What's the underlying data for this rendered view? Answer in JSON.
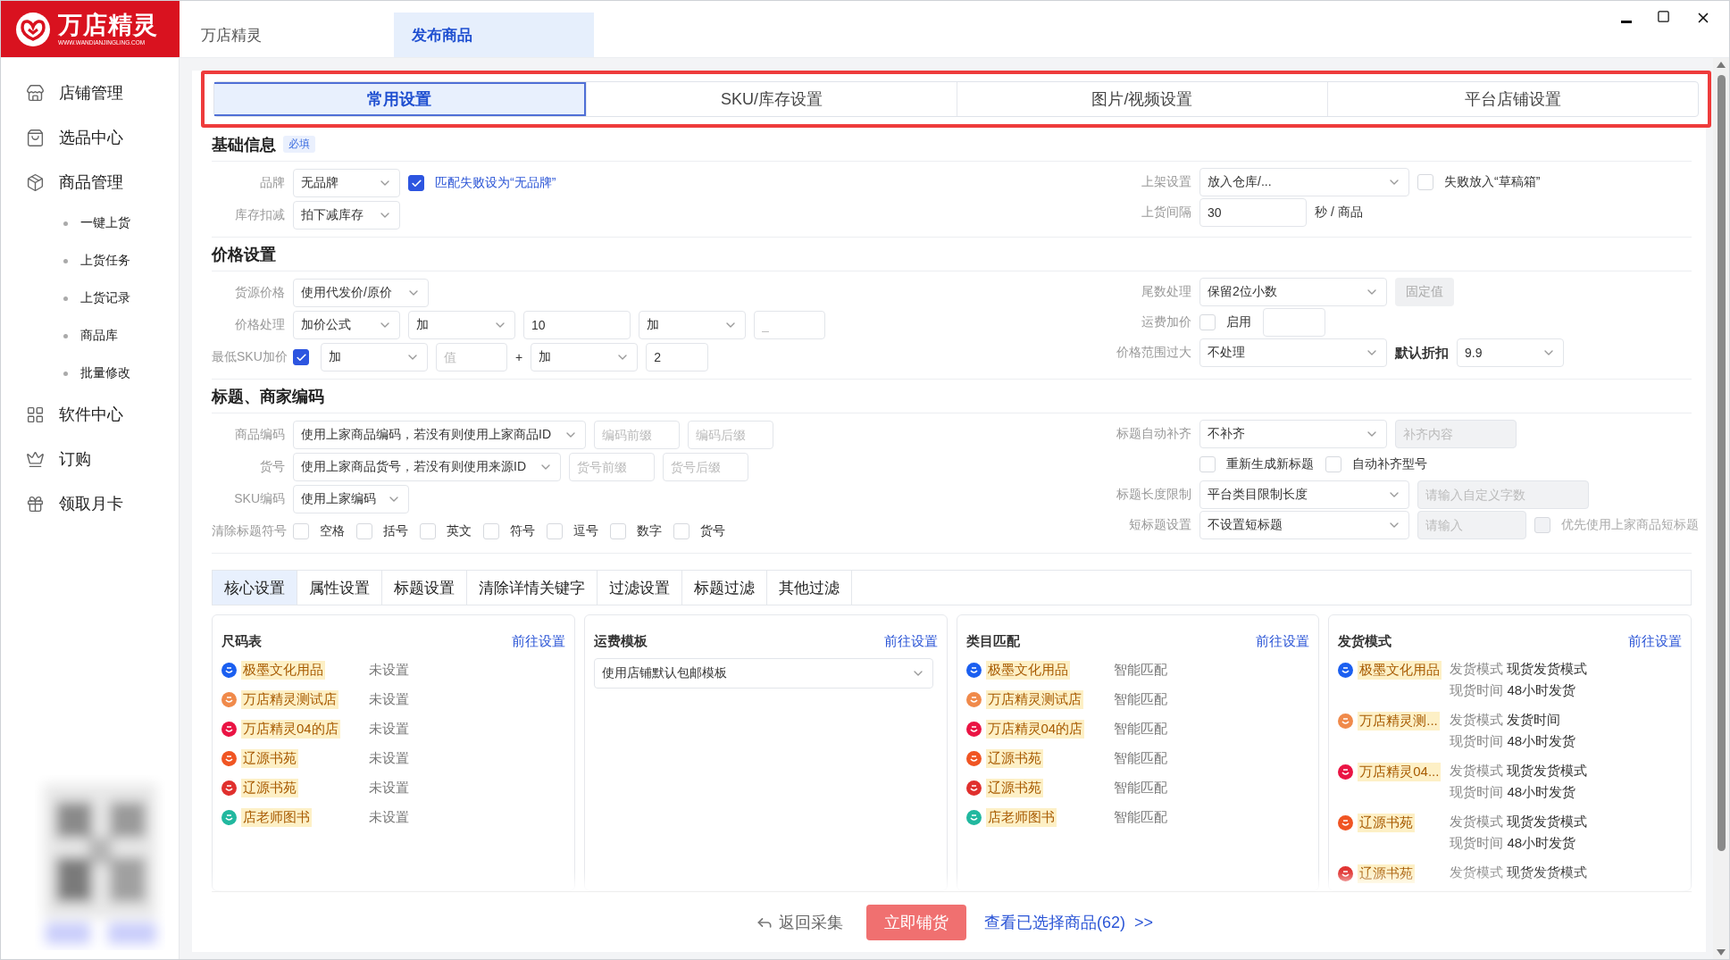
{
  "app": {
    "logo_text": "万店精灵",
    "logo_url": "WWW.WANDIANJINGLING.COM"
  },
  "window_tabs": [
    {
      "label": "万店精灵",
      "selected": false
    },
    {
      "label": "发布商品",
      "selected": true
    }
  ],
  "sidebar": {
    "items": [
      {
        "label": "店铺管理"
      },
      {
        "label": "选品中心"
      },
      {
        "label": "商品管理",
        "children": [
          {
            "label": "一键上货"
          },
          {
            "label": "上货任务"
          },
          {
            "label": "上货记录"
          },
          {
            "label": "商品库"
          },
          {
            "label": "批量修改"
          }
        ]
      },
      {
        "label": "软件中心"
      },
      {
        "label": "订购"
      },
      {
        "label": "领取月卡"
      }
    ]
  },
  "settings_tabs": [
    {
      "label": "常用设置",
      "selected": true
    },
    {
      "label": "SKU/库存设置",
      "selected": false
    },
    {
      "label": "图片/视频设置",
      "selected": false
    },
    {
      "label": "平台店铺设置",
      "selected": false
    }
  ],
  "sections": [
    {
      "title": "基础信息",
      "badge": "必填",
      "left": [
        {
          "label": "品牌",
          "controls": [
            {
              "kind": "select",
              "value": "无品牌"
            },
            {
              "kind": "checkbox",
              "label": "匹配失败设为“无品牌”",
              "checked": true,
              "accent": true
            }
          ]
        },
        {
          "label": "库存扣减",
          "controls": [
            {
              "kind": "select",
              "value": "拍下减库存"
            }
          ]
        }
      ],
      "right": [
        {
          "label": "上架设置",
          "controls": [
            {
              "kind": "select",
              "value": "放入仓库/..."
            },
            {
              "kind": "checkbox",
              "label": "失败放入“草稿箱”",
              "checked": false
            }
          ]
        },
        {
          "label": "上货间隔",
          "controls": [
            {
              "kind": "input",
              "value": "30"
            },
            {
              "kind": "text",
              "text": "秒 / 商品"
            }
          ]
        }
      ]
    },
    {
      "title": "价格设置",
      "left": [
        {
          "label": "货源价格",
          "controls": [
            {
              "kind": "select",
              "value": "使用代发价/原价"
            }
          ]
        },
        {
          "label": "价格处理",
          "controls": [
            {
              "kind": "select",
              "value": "加价公式"
            },
            {
              "kind": "select",
              "value": "加"
            },
            {
              "kind": "input",
              "value": "10"
            },
            {
              "kind": "select",
              "value": "加"
            },
            {
              "kind": "input",
              "placeholder": "_"
            }
          ]
        },
        {
          "label": "最低SKU加价",
          "controls": [
            {
              "kind": "checkbox",
              "checked": true
            },
            {
              "kind": "select",
              "value": "加"
            },
            {
              "kind": "input",
              "placeholder": "值"
            },
            {
              "kind": "text",
              "text": "+"
            },
            {
              "kind": "select",
              "value": "加"
            },
            {
              "kind": "input",
              "value": "2"
            }
          ]
        }
      ],
      "right": [
        {
          "label": "尾数处理",
          "controls": [
            {
              "kind": "select",
              "value": "保留2位小数"
            },
            {
              "kind": "button",
              "label": "固定值",
              "disabled": true
            }
          ]
        },
        {
          "label": "运费加价",
          "controls": [
            {
              "kind": "checkbox",
              "label": "启用",
              "checked": false
            },
            {
              "kind": "input"
            }
          ]
        },
        {
          "label": "价格范围过大",
          "controls": [
            {
              "kind": "select",
              "value": "不处理"
            },
            {
              "kind": "text",
              "text": "默认折扣",
              "strong": true
            },
            {
              "kind": "select",
              "value": "9.9"
            }
          ]
        }
      ]
    },
    {
      "title": "标题、商家编码",
      "left": [
        {
          "label": "商品编码",
          "controls": [
            {
              "kind": "select",
              "value": "使用上家商品编码，若没有则使用上家商品ID"
            },
            {
              "kind": "input",
              "placeholder": "编码前缀"
            },
            {
              "kind": "input",
              "placeholder": "编码后缀"
            }
          ]
        },
        {
          "label": "货号",
          "controls": [
            {
              "kind": "select",
              "value": "使用上家商品货号，若没有则使用来源ID"
            },
            {
              "kind": "input",
              "placeholder": "货号前缀"
            },
            {
              "kind": "input",
              "placeholder": "货号后缀"
            }
          ]
        },
        {
          "label": "SKU编码",
          "controls": [
            {
              "kind": "select",
              "value": "使用上家编码"
            }
          ]
        },
        {
          "label": "清除标题符号",
          "controls": [
            {
              "kind": "checkbox",
              "label": "空格",
              "checked": false
            },
            {
              "kind": "checkbox",
              "label": "括号",
              "checked": false
            },
            {
              "kind": "checkbox",
              "label": "英文",
              "checked": false
            },
            {
              "kind": "checkbox",
              "label": "符号",
              "checked": false
            },
            {
              "kind": "checkbox",
              "label": "逗号",
              "checked": false
            },
            {
              "kind": "checkbox",
              "label": "数字",
              "checked": false
            },
            {
              "kind": "checkbox",
              "label": "货号",
              "checked": false
            }
          ]
        }
      ],
      "right": [
        {
          "label": "标题自动补齐",
          "controls": [
            {
              "kind": "select",
              "value": "不补齐"
            },
            {
              "kind": "input",
              "placeholder": "补齐内容",
              "disabled": true
            }
          ]
        },
        {
          "controls": [
            {
              "kind": "checkbox",
              "label": "重新生成新标题",
              "checked": false
            },
            {
              "kind": "checkbox",
              "label": "自动补齐型号",
              "checked": false
            }
          ]
        },
        {
          "label": "标题长度限制",
          "controls": [
            {
              "kind": "select",
              "value": "平台类目限制长度"
            },
            {
              "kind": "input",
              "placeholder": "请输入自定义字数",
              "disabled": true
            }
          ]
        },
        {
          "label": "短标题设置",
          "controls": [
            {
              "kind": "select",
              "value": "不设置短标题"
            },
            {
              "kind": "input",
              "placeholder": "请输入",
              "disabled": true
            },
            {
              "kind": "checkbox",
              "label": "优先使用上家商品短标题",
              "checked": false,
              "disabled": true
            }
          ]
        }
      ]
    }
  ],
  "detail_tabs": [
    {
      "label": "核心设置",
      "selected": true
    },
    {
      "label": "属性设置",
      "selected": false
    },
    {
      "label": "标题设置",
      "selected": false
    },
    {
      "label": "清除详情关键字",
      "selected": false
    },
    {
      "label": "过滤设置",
      "selected": false
    },
    {
      "label": "标题过滤",
      "selected": false
    },
    {
      "label": "其他过滤",
      "selected": false
    }
  ],
  "cards": [
    {
      "kind": "status",
      "title": "尺码表",
      "link": "前往设置",
      "rows": [
        {
          "shop": "极墨文化用品",
          "color": "#1b5ff0",
          "status": "未设置"
        },
        {
          "shop": "万店精灵测试店",
          "color": "#f08a4b",
          "status": "未设置"
        },
        {
          "shop": "万店精灵04的店",
          "color": "#ea1444",
          "status": "未设置"
        },
        {
          "shop": "辽源书苑",
          "color": "#f05523",
          "status": "未设置"
        },
        {
          "shop": "辽源书苑",
          "color": "#e0302e",
          "status": "未设置"
        },
        {
          "shop": "店老师图书",
          "color": "#21b89f",
          "status": "未设置"
        }
      ]
    },
    {
      "kind": "select",
      "title": "运费模板",
      "link": "前往设置",
      "value": "使用店铺默认包邮模板"
    },
    {
      "kind": "status",
      "title": "类目匹配",
      "link": "前往设置",
      "rows": [
        {
          "shop": "极墨文化用品",
          "color": "#1b5ff0",
          "status": "智能匹配"
        },
        {
          "shop": "万店精灵测试店",
          "color": "#f08a4b",
          "status": "智能匹配"
        },
        {
          "shop": "万店精灵04的店",
          "color": "#ea1444",
          "status": "智能匹配"
        },
        {
          "shop": "辽源书苑",
          "color": "#f05523",
          "status": "智能匹配"
        },
        {
          "shop": "辽源书苑",
          "color": "#e0302e",
          "status": "智能匹配"
        },
        {
          "shop": "店老师图书",
          "color": "#21b89f",
          "status": "智能匹配"
        }
      ]
    },
    {
      "kind": "shipping",
      "title": "发货模式",
      "link": "前往设置",
      "rows": [
        {
          "shop": "极墨文化用品",
          "color": "#1b5ff0",
          "lines": [
            {
              "label": "发货模式",
              "value": "现货发货模式"
            },
            {
              "label": "现货时间",
              "value": "48小时发货"
            }
          ]
        },
        {
          "shop": "万店精灵测...",
          "color": "#f08a4b",
          "lines": [
            {
              "label": "发货模式",
              "value": "发货时间"
            },
            {
              "label": "现货时间",
              "value": "48小时发货"
            }
          ]
        },
        {
          "shop": "万店精灵04...",
          "color": "#ea1444",
          "lines": [
            {
              "label": "发货模式",
              "value": "现货发货模式"
            },
            {
              "label": "现货时间",
              "value": "48小时发货"
            }
          ]
        },
        {
          "shop": "辽源书苑",
          "color": "#f05523",
          "lines": [
            {
              "label": "发货模式",
              "value": "现货发货模式"
            },
            {
              "label": "现货时间",
              "value": "48小时发货"
            }
          ]
        },
        {
          "shop": "辽源书苑",
          "color": "#e0302e",
          "lines": [
            {
              "label": "发货模式",
              "value": "现货发货模式"
            }
          ]
        }
      ]
    }
  ],
  "footer": {
    "back": "返回采集",
    "primary": "立即铺货",
    "link": "查看已选择商品(62)  >>"
  }
}
